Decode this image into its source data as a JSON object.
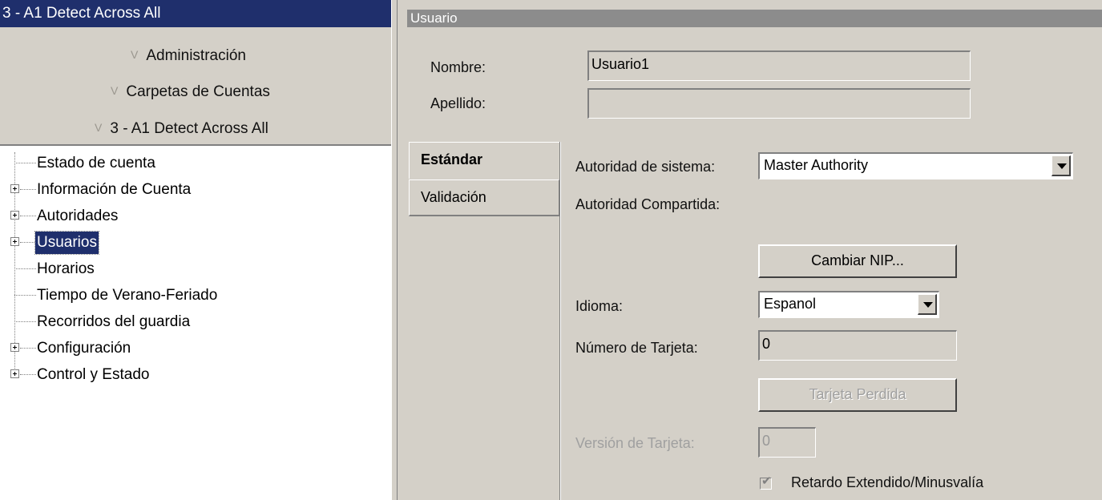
{
  "left_pane": {
    "title": "3 - A1 Detect Across All",
    "nav": [
      {
        "label": "Administración",
        "icon": "chevron-down-icon"
      },
      {
        "label": "Carpetas de Cuentas",
        "icon": "chevron-down-icon"
      },
      {
        "label": "3 - A1 Detect Across All",
        "icon": "chevron-down-icon"
      }
    ],
    "chevron_glyph": "V",
    "tree": [
      {
        "label": "Estado de cuenta",
        "expandable": false
      },
      {
        "label": "Información de Cuenta",
        "expandable": true
      },
      {
        "label": "Autoridades",
        "expandable": true
      },
      {
        "label": "Usuarios",
        "expandable": true,
        "selected": true
      },
      {
        "label": "Horarios",
        "expandable": false
      },
      {
        "label": "Tiempo de Verano-Feriado",
        "expandable": false
      },
      {
        "label": "Recorridos del guardia",
        "expandable": false
      },
      {
        "label": "Configuración",
        "expandable": true
      },
      {
        "label": "Control y Estado",
        "expandable": true
      }
    ]
  },
  "right_pane": {
    "title": "Usuario",
    "nombre_label": "Nombre:",
    "nombre_value": "Usuario1",
    "apellido_label": "Apellido:",
    "apellido_value": "",
    "tabs": [
      {
        "label": "Estándar",
        "active": true
      },
      {
        "label": "Validación",
        "active": false
      }
    ],
    "standard": {
      "autoridad_sistema_label": "Autoridad de sistema:",
      "autoridad_sistema_value": "Master Authority",
      "autoridad_compartida_label": "Autoridad Compartida:",
      "cambiar_nip_label": "Cambiar NIP...",
      "idioma_label": "Idioma:",
      "idioma_value": "Espanol",
      "numero_tarjeta_label": "Número de Tarjeta:",
      "numero_tarjeta_value": "0",
      "tarjeta_perdida_label": "Tarjeta Perdida",
      "version_tarjeta_label": "Versión de Tarjeta:",
      "version_tarjeta_value": "0",
      "retardo_label": "Retardo Extendido/Minusvalía",
      "retardo_checked": true
    }
  },
  "colors": {
    "title_bar": "#1f2f6c",
    "panel_bg": "#d4d0c8",
    "right_title_bar": "#8c8c8c"
  }
}
